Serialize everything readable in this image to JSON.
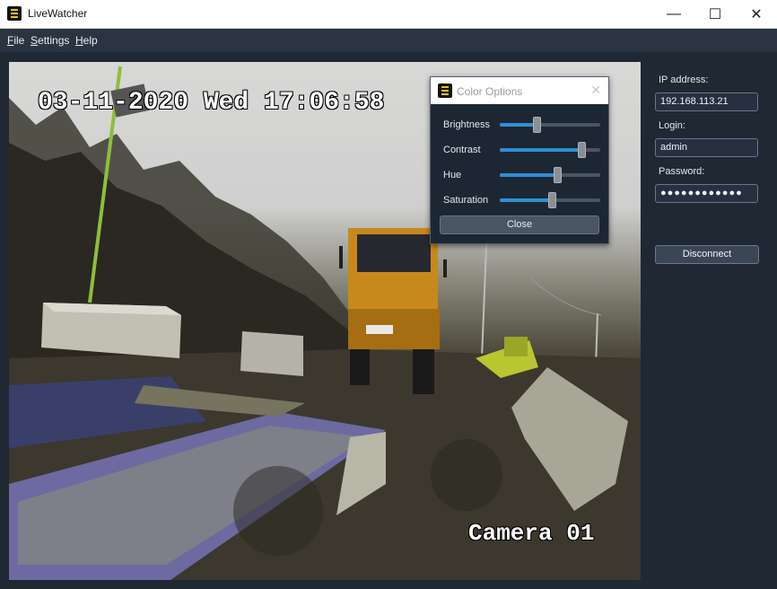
{
  "window": {
    "title": "LiveWatcher",
    "minimize_glyph": "—",
    "maximize_glyph": "☐",
    "close_glyph": "✕"
  },
  "menu": {
    "file": "File",
    "settings": "Settings",
    "help": "Help"
  },
  "camera": {
    "timestamp": "03-11-2020 Wed 17:06:58",
    "label": "Camera 01"
  },
  "color_options": {
    "title": "Color Options",
    "close_glyph": "✕",
    "brightness_label": "Brightness",
    "contrast_label": "Contrast",
    "hue_label": "Hue",
    "saturation_label": "Saturation",
    "brightness_value": 0.37,
    "contrast_value": 0.81,
    "hue_value": 0.57,
    "saturation_value": 0.52,
    "close_label": "Close"
  },
  "connection": {
    "ip_label": "IP address:",
    "ip_value": "192.168.113.21",
    "login_label": "Login:",
    "login_value": "admin",
    "password_label": "Password:",
    "password_value": "●●●●●●●●●●●●",
    "disconnect_label": "Disconnect"
  },
  "colors": {
    "accent": "#2f8fd6",
    "background": "#1f2833"
  }
}
